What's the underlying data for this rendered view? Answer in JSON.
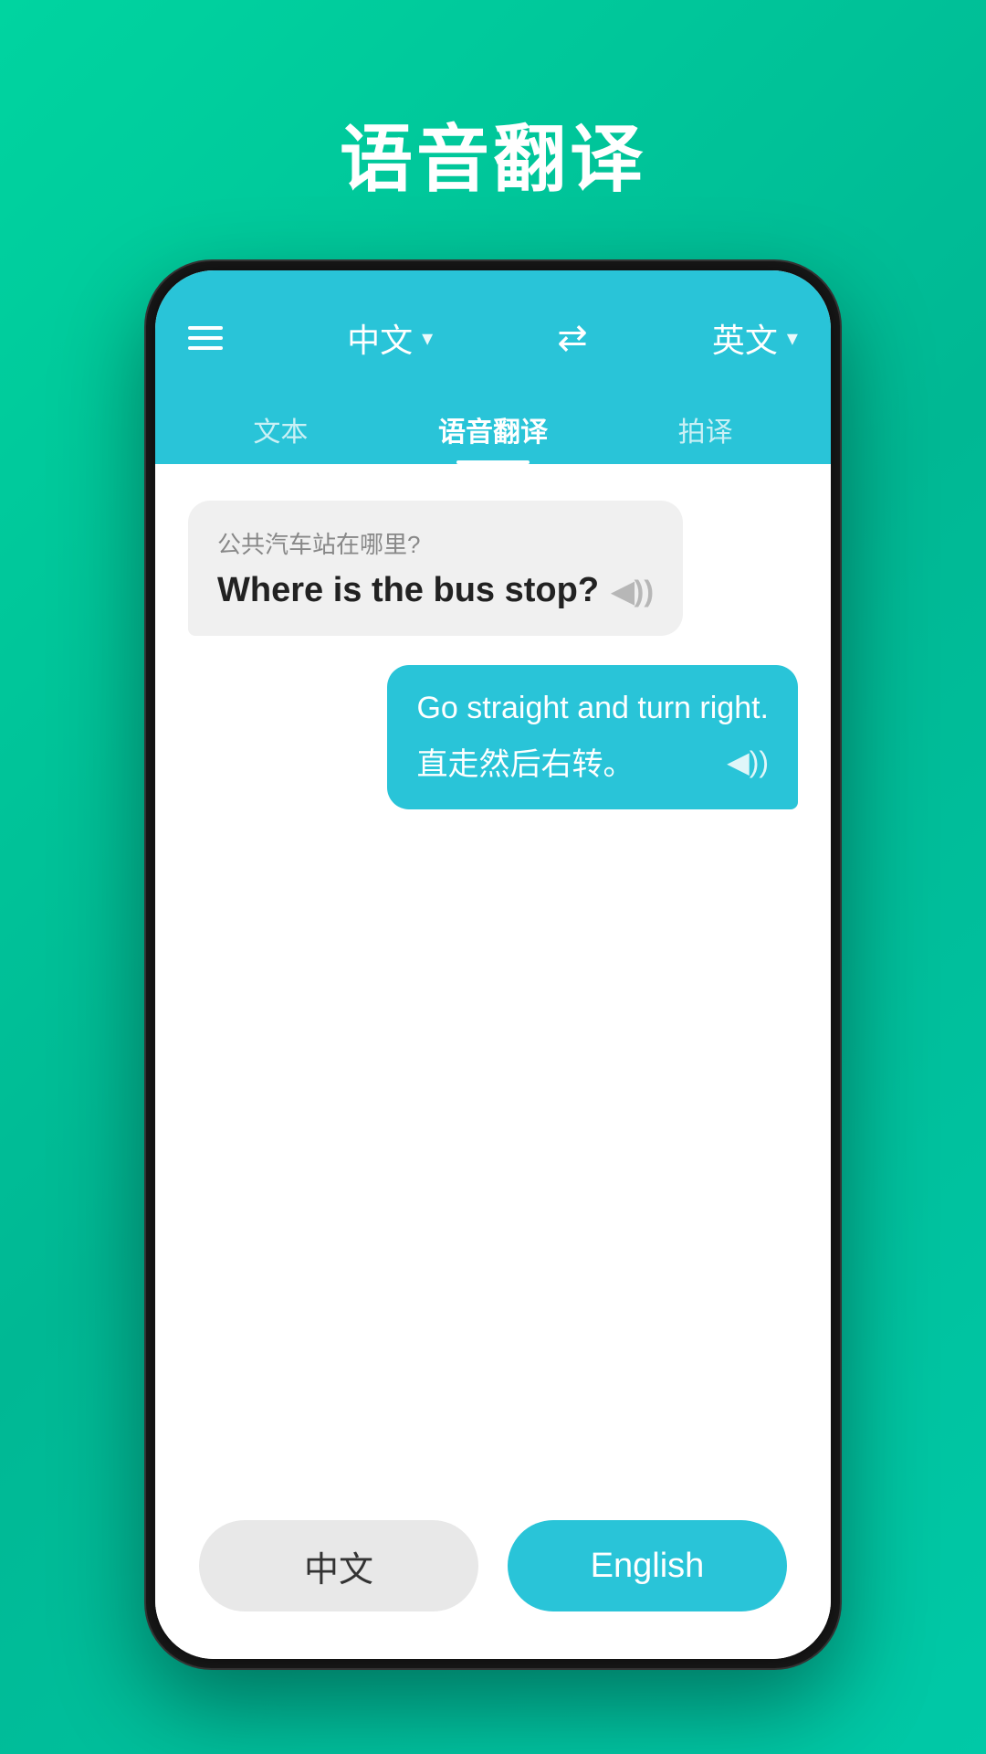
{
  "page": {
    "title": "语音翻译",
    "background_color": "#00c9a7"
  },
  "header": {
    "source_lang": "中文",
    "target_lang": "英文",
    "menu_label": "menu",
    "swap_label": "swap languages"
  },
  "tabs": [
    {
      "label": "文本",
      "active": false
    },
    {
      "label": "语音翻译",
      "active": true
    },
    {
      "label": "拍译",
      "active": false
    }
  ],
  "messages": [
    {
      "direction": "left",
      "original": "公共汽车站在哪里?",
      "translation": "Where is the bus stop?",
      "has_audio": true
    },
    {
      "direction": "right",
      "original": "Go straight and turn right.",
      "translation": "直走然后右转。",
      "has_audio": true
    }
  ],
  "bottom_buttons": {
    "chinese_label": "中文",
    "english_label": "English"
  },
  "icons": {
    "sound": "◀))",
    "swap": "⇄"
  }
}
